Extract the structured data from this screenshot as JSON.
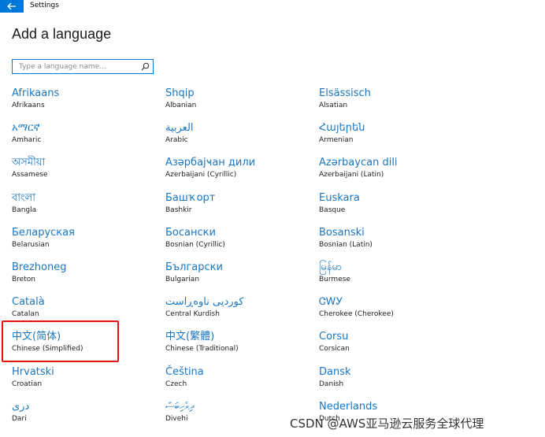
{
  "window": {
    "title": "Settings"
  },
  "page": {
    "title": "Add a language"
  },
  "search": {
    "placeholder": "Type a language name..."
  },
  "columns": [
    [
      {
        "native": "Afrikaans",
        "english": "Afrikaans"
      },
      {
        "native": "አማርኛ",
        "english": "Amharic"
      },
      {
        "native": "অসমীয়া",
        "english": "Assamese"
      },
      {
        "native": "বাংলা",
        "english": "Bangla"
      },
      {
        "native": "Беларуская",
        "english": "Belarusian"
      },
      {
        "native": "Brezhoneg",
        "english": "Breton"
      },
      {
        "native": "Català",
        "english": "Catalan"
      },
      {
        "native": "中文(简体)",
        "english": "Chinese (Simplified)"
      },
      {
        "native": "Hrvatski",
        "english": "Croatian"
      },
      {
        "native": "دری",
        "english": "Dari"
      }
    ],
    [
      {
        "native": "Shqip",
        "english": "Albanian"
      },
      {
        "native": "العربية",
        "english": "Arabic"
      },
      {
        "native": "Азәрбајҹан дили",
        "english": "Azerbaijani (Cyrillic)"
      },
      {
        "native": "Башҡорт",
        "english": "Bashkir"
      },
      {
        "native": "Босански",
        "english": "Bosnian (Cyrillic)"
      },
      {
        "native": "Български",
        "english": "Bulgarian"
      },
      {
        "native": "کوردیی ناوەڕاست",
        "english": "Central Kurdish"
      },
      {
        "native": "中文(繁體)",
        "english": "Chinese (Traditional)"
      },
      {
        "native": "Čeština",
        "english": "Czech"
      },
      {
        "native": "ދިވެހިބަސް",
        "english": "Divehi"
      }
    ],
    [
      {
        "native": "Elsässisch",
        "english": "Alsatian"
      },
      {
        "native": "Հայերեն",
        "english": "Armenian"
      },
      {
        "native": "Azərbaycan dili",
        "english": "Azerbaijani (Latin)"
      },
      {
        "native": "Euskara",
        "english": "Basque"
      },
      {
        "native": "Bosanski",
        "english": "Bosnian (Latin)"
      },
      {
        "native": "မြန်မာ",
        "english": "Burmese"
      },
      {
        "native": "ᏣᎳᎩ",
        "english": "Cherokee (Cherokee)"
      },
      {
        "native": "Corsu",
        "english": "Corsican"
      },
      {
        "native": "Dansk",
        "english": "Danish"
      },
      {
        "native": "Nederlands",
        "english": "Dutch"
      }
    ]
  ],
  "watermark": "CSDN @AWS亚马逊云服务全球代理",
  "colors": {
    "accent": "#0078d7",
    "link": "#1a76c2",
    "highlight": "#e21414"
  }
}
